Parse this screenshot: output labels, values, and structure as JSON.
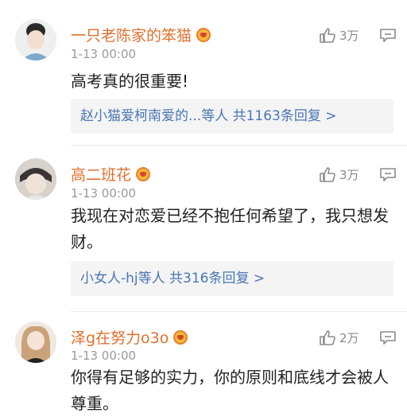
{
  "comments": [
    {
      "username": "一只老陈家的笨猫",
      "time": "1-13 00:00",
      "likes": "3万",
      "text": "高考真的很重要!",
      "replies": "赵小猫爱柯南爱的...等人  共1163条回复 >"
    },
    {
      "username": "高二班花",
      "time": "1-13 00:00",
      "likes": "3万",
      "text": "我现在对恋爱已经不抱任何希望了，我只想发财。",
      "replies": "小女人-hj等人  共316条回复 >"
    },
    {
      "username": "泽g在努力o3o",
      "time": "1-13 00:00",
      "likes": "2万",
      "text": "你得有足够的实力，你的原则和底线才会被人尊重。",
      "replies": ""
    }
  ],
  "icons": {
    "like": "thumbs-up-icon",
    "reply": "comment-icon",
    "badge": "crown-badge-icon"
  },
  "colors": {
    "username": "#e0702e",
    "reply_link": "#4a76b4",
    "meta": "#9a9a9a"
  }
}
